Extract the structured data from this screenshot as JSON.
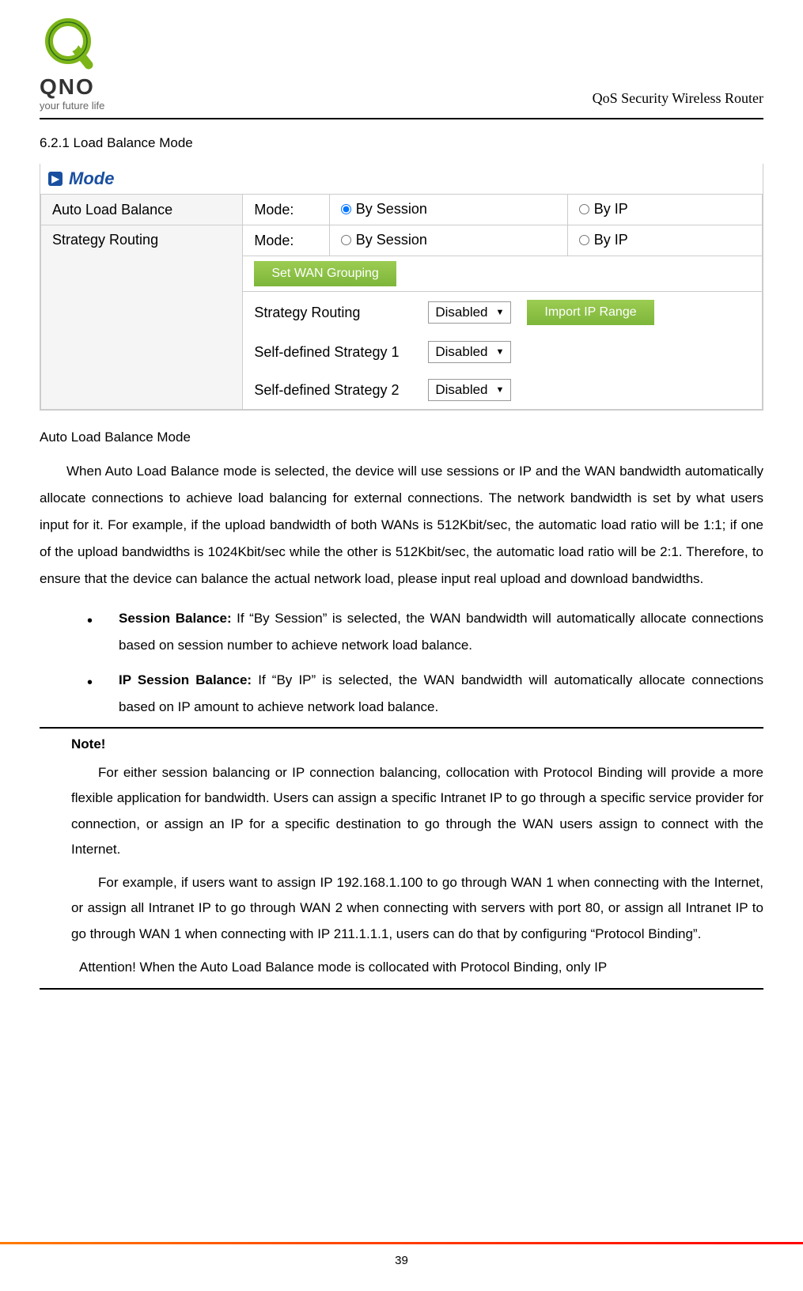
{
  "header": {
    "brand": "QNO",
    "tagline": "your future life",
    "title": "QoS Security Wireless Router"
  },
  "section": {
    "number": "6.2.1 Load Balance Mode"
  },
  "mode_panel": {
    "title": "Mode",
    "rows": [
      {
        "name": "Auto Load Balance",
        "label": "Mode:",
        "opt1": "By Session",
        "opt2": "By IP",
        "selected": 0
      },
      {
        "name": "Strategy Routing",
        "label": "Mode:",
        "opt1": "By Session",
        "opt2": "By IP",
        "selected": -1
      }
    ],
    "set_wan_grouping": "Set WAN Grouping",
    "import_ip_range": "Import IP Range",
    "strategy": [
      {
        "label": "Strategy Routing",
        "value": "Disabled"
      },
      {
        "label": "Self-defined Strategy 1",
        "value": "Disabled"
      },
      {
        "label": "Self-defined Strategy 2",
        "value": "Disabled"
      }
    ]
  },
  "body": {
    "h1": "Auto Load Balance Mode",
    "p1": "When Auto Load Balance mode is selected, the device will use sessions or IP and the WAN bandwidth automatically allocate connections to achieve load balancing for external connections. The network bandwidth is set by what users input for it. For example, if the upload bandwidth of both WANs is 512Kbit/sec, the automatic load ratio will be 1:1; if one of the upload bandwidths is 1024Kbit/sec while the other is 512Kbit/sec, the automatic load ratio will be 2:1. Therefore, to ensure that the device can balance the actual network load, please input real upload and download bandwidths.",
    "bullets": [
      {
        "title": "Session Balance:",
        "text": " If “By Session” is selected, the WAN bandwidth will automatically allocate connections based on session number to achieve network load balance."
      },
      {
        "title": "IP Session Balance:",
        "text": " If “By IP” is selected, the WAN bandwidth will automatically allocate connections based on IP amount to achieve network load balance."
      }
    ],
    "note_title": "Note!",
    "note_p1": "For either session balancing or IP connection balancing, collocation with Protocol Binding will provide a more flexible application for bandwidth. Users can assign a specific Intranet IP to go through a specific service provider for connection, or assign an IP for a specific destination to go through the WAN users assign to connect with the Internet.",
    "note_p2": "For example, if users want to assign IP 192.168.1.100 to go through WAN 1 when connecting with the Internet, or assign all Intranet IP to go through WAN 2 when connecting with servers with port 80, or assign all Intranet IP to go through WAN 1 when connecting with IP 211.1.1.1, users can do that by configuring “Protocol Binding”.",
    "attention": "Attention! When the Auto Load Balance mode is collocated with Protocol Binding, only IP"
  },
  "footer": {
    "page": "39"
  }
}
